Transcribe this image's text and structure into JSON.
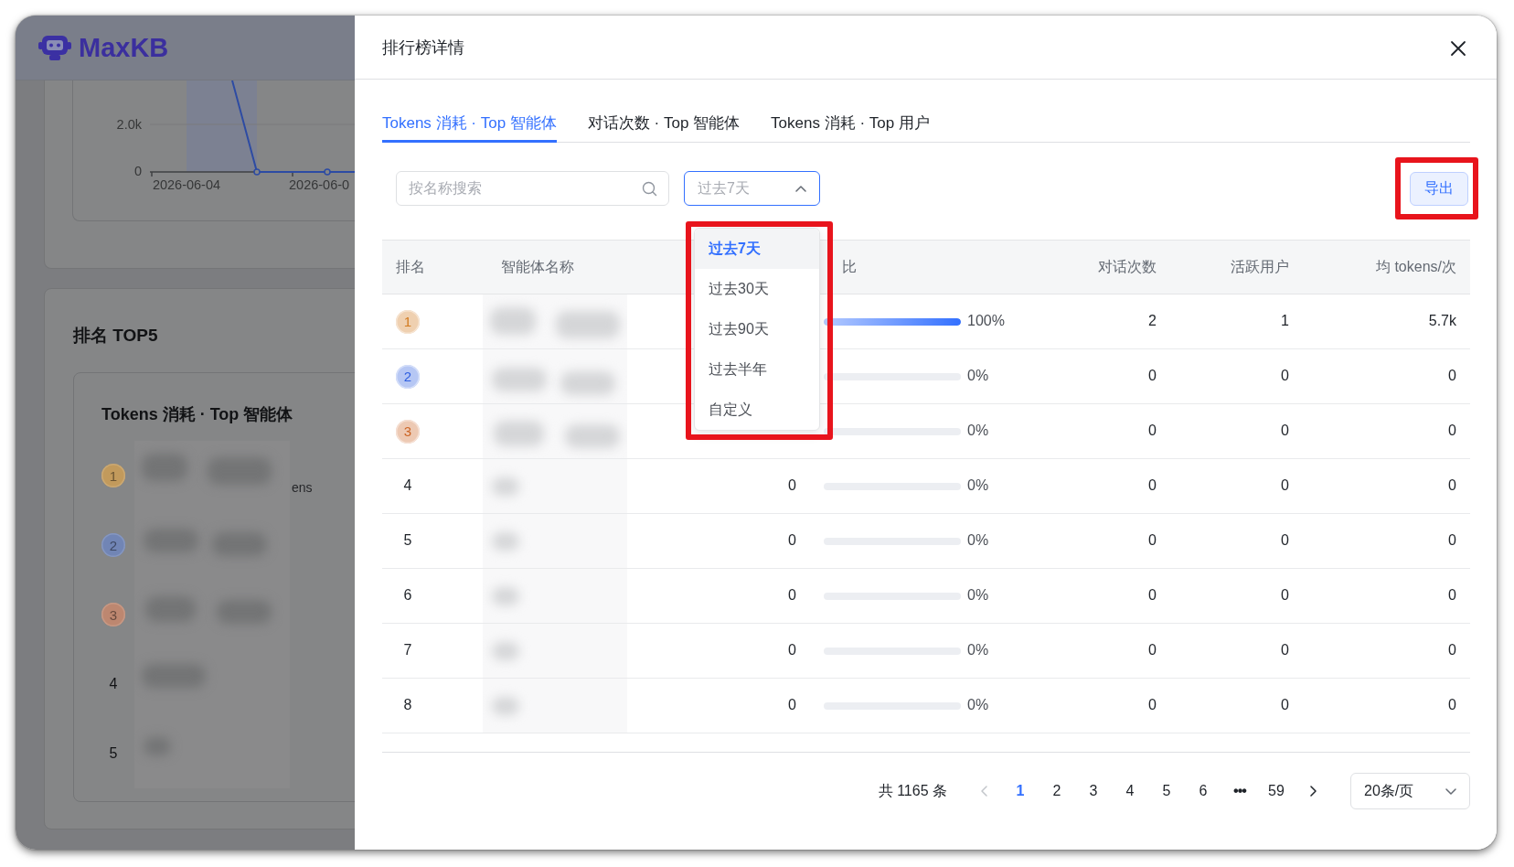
{
  "app": {
    "logo": "MaxKB"
  },
  "background": {
    "chart": {
      "y_ticks": [
        "2.0k",
        "0"
      ],
      "x_labels": [
        "2026-06-04",
        "2026-06-0"
      ]
    },
    "ranking": {
      "title": "排名 TOP5",
      "panel_title": "Tokens 消耗 · Top 智能体",
      "items": [
        {
          "rank": "1",
          "color": "#c29a5c",
          "name_blurred": true,
          "fragment": "ens"
        },
        {
          "rank": "2",
          "color": "#7185b5",
          "name_blurred": true
        },
        {
          "rank": "3",
          "color": "#bd8770",
          "name_blurred": true
        },
        {
          "rank": "4",
          "name_blurred": true
        },
        {
          "rank": "5",
          "name_blurred": true
        }
      ]
    }
  },
  "drawer": {
    "title": "排行榜详情",
    "tabs": [
      {
        "label": "Tokens 消耗 · Top 智能体",
        "selected": true
      },
      {
        "label": "对话次数 · Top 智能体",
        "selected": false
      },
      {
        "label": "Tokens 消耗 · Top 用户",
        "selected": false
      }
    ],
    "search": {
      "placeholder": "按名称搜索"
    },
    "period_select": {
      "value": "过去7天",
      "expanded": true,
      "highlighted": true,
      "options": [
        {
          "label": "过去7天",
          "selected": true
        },
        {
          "label": "过去30天",
          "selected": false
        },
        {
          "label": "过去90天",
          "selected": false
        },
        {
          "label": "过去半年",
          "selected": false
        },
        {
          "label": "自定义",
          "selected": false
        }
      ]
    },
    "export_button": {
      "label": "导出",
      "highlighted": true
    },
    "table": {
      "columns": {
        "rank": "排名",
        "name": "智能体名称",
        "column_4": "比",
        "conversations": "对话次数",
        "active_users": "活跃用户",
        "avg_tokens": "均 tokens/次"
      },
      "rows": [
        {
          "rank": "1",
          "color": "#d27a1e",
          "name_blurred": true,
          "level": 1,
          "column_4": "100%",
          "conversations": "2",
          "active_users": "1",
          "avg_tokens": "5.7k"
        },
        {
          "rank": "2",
          "color": "#2f5fe0",
          "name_blurred": true,
          "level": 0,
          "column_4": "0%",
          "conversations": "0",
          "active_users": "0",
          "avg_tokens": "0"
        },
        {
          "rank": "3",
          "color": "#cc6526",
          "name_blurred": true,
          "level": 0,
          "column_4": "0%",
          "conversations": "0",
          "active_users": "0",
          "avg_tokens": "0"
        },
        {
          "rank": "4",
          "name_blurred": true,
          "column_3": "0",
          "level": 0,
          "column_4": "0%",
          "conversations": "0",
          "active_users": "0",
          "avg_tokens": "0"
        },
        {
          "rank": "5",
          "name_blurred": true,
          "column_3": "0",
          "level": 0,
          "column_4": "0%",
          "conversations": "0",
          "active_users": "0",
          "avg_tokens": "0"
        },
        {
          "rank": "6",
          "name_blurred": true,
          "column_3": "0",
          "level": 0,
          "column_4": "0%",
          "conversations": "0",
          "active_users": "0",
          "avg_tokens": "0"
        },
        {
          "rank": "7",
          "name_blurred": true,
          "column_3": "0",
          "level": 0,
          "column_4": "0%",
          "conversations": "0",
          "active_users": "0",
          "avg_tokens": "0"
        },
        {
          "rank": "8",
          "name_blurred": true,
          "column_3": "0",
          "level": 0,
          "column_4": "0%",
          "conversations": "0",
          "active_users": "0",
          "avg_tokens": "0"
        }
      ]
    },
    "pagination": {
      "total": "共 1165 条",
      "prev_disabled": true,
      "next_disabled": false,
      "pages": [
        {
          "label": "1",
          "kind": "page",
          "selected": true
        },
        {
          "label": "2",
          "kind": "page",
          "selected": false
        },
        {
          "label": "3",
          "kind": "page",
          "selected": false
        },
        {
          "label": "4",
          "kind": "page",
          "selected": false
        },
        {
          "label": "5",
          "kind": "page",
          "selected": false
        },
        {
          "label": "6",
          "kind": "page",
          "selected": false
        },
        {
          "label": "•••",
          "kind": "ellipsis",
          "selected": false
        },
        {
          "label": "59",
          "kind": "page",
          "selected": false
        }
      ],
      "page_size": "20条/页"
    }
  }
}
